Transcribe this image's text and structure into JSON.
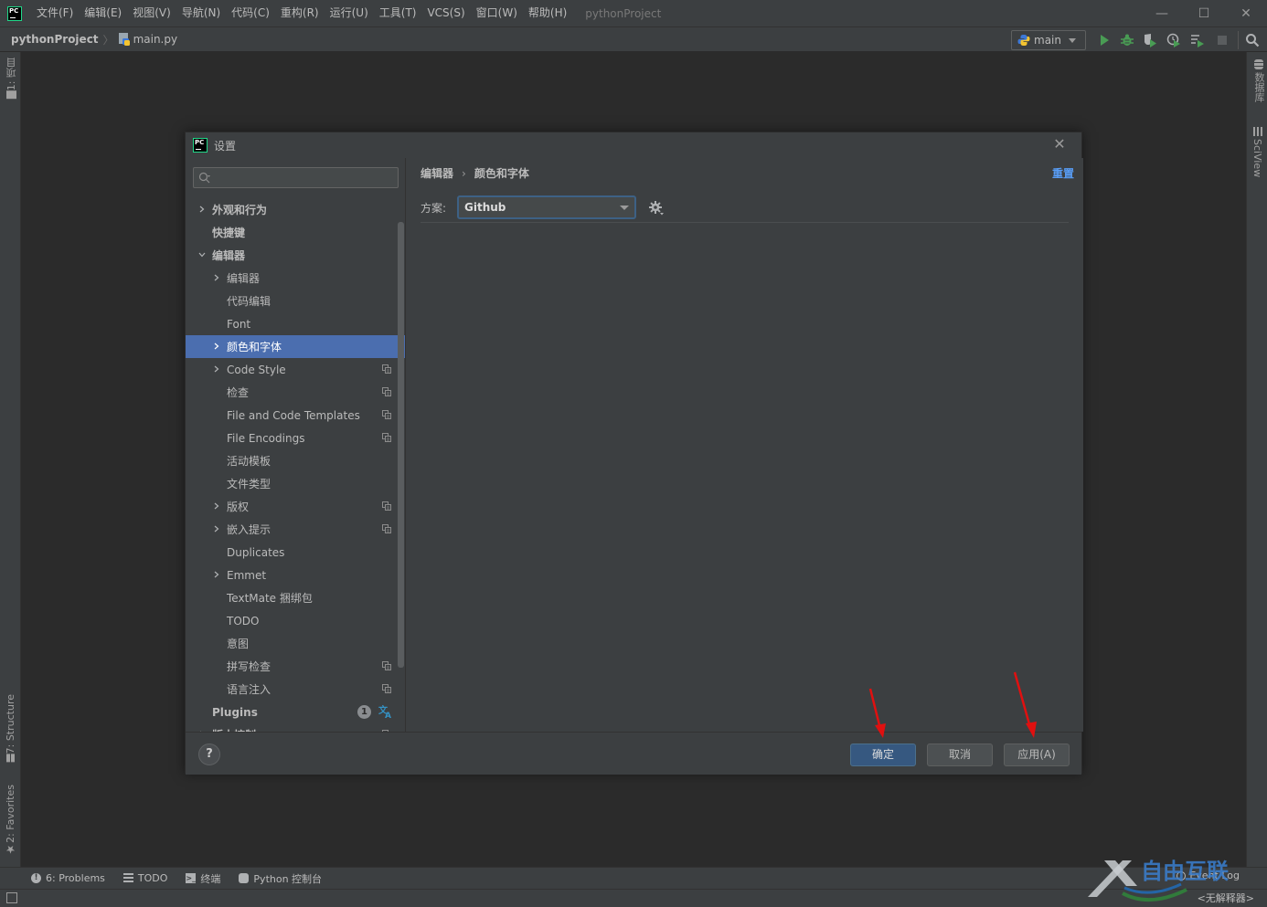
{
  "app": {
    "logo_text": "PC",
    "menu": [
      "文件(F)",
      "编辑(E)",
      "视图(V)",
      "导航(N)",
      "代码(C)",
      "重构(R)",
      "运行(U)",
      "工具(T)",
      "VCS(S)",
      "窗口(W)",
      "帮助(H)"
    ],
    "window_title": "pythonProject",
    "window_controls": {
      "minimize": "—",
      "maximize": "☐",
      "close": "✕"
    }
  },
  "navbar": {
    "project": "pythonProject",
    "file": "main.py",
    "run_config": "main"
  },
  "left_strip": {
    "top_tab": "1: 项目",
    "structure_tab": "7: Structure",
    "favorites_tab": "2: Favorites"
  },
  "right_strip": {
    "database_tab": "数据库",
    "sciview_tab": "SciView"
  },
  "bottom_bar": {
    "tabs": [
      "6: Problems",
      "TODO",
      "终端",
      "Python 控制台"
    ]
  },
  "status": {
    "event_log": "Event Log",
    "interpreter": "<无解释器>"
  },
  "dialog": {
    "logo_text": "PC",
    "title": "设置",
    "close": "✕",
    "search": {
      "value": "",
      "placeholder": ""
    },
    "tree": [
      {
        "label": "外观和行为",
        "level": 0,
        "arrow": "right",
        "bold": true,
        "copy": false
      },
      {
        "label": "快捷键",
        "level": 0,
        "arrow": "none",
        "bold": true,
        "copy": false
      },
      {
        "label": "编辑器",
        "level": 0,
        "arrow": "down",
        "bold": true,
        "copy": false
      },
      {
        "label": "编辑器",
        "level": 1,
        "arrow": "right",
        "bold": false,
        "copy": false
      },
      {
        "label": "代码编辑",
        "level": 1,
        "arrow": "none",
        "bold": false,
        "copy": false
      },
      {
        "label": "Font",
        "level": 1,
        "arrow": "none",
        "bold": false,
        "copy": false
      },
      {
        "label": "颜色和字体",
        "level": 1,
        "arrow": "right",
        "bold": false,
        "copy": false,
        "selected": true
      },
      {
        "label": "Code Style",
        "level": 1,
        "arrow": "right",
        "bold": false,
        "copy": true
      },
      {
        "label": "检查",
        "level": 1,
        "arrow": "none",
        "bold": false,
        "copy": true
      },
      {
        "label": "File and Code Templates",
        "level": 1,
        "arrow": "none",
        "bold": false,
        "copy": true
      },
      {
        "label": "File Encodings",
        "level": 1,
        "arrow": "none",
        "bold": false,
        "copy": true
      },
      {
        "label": "活动模板",
        "level": 1,
        "arrow": "none",
        "bold": false,
        "copy": false
      },
      {
        "label": "文件类型",
        "level": 1,
        "arrow": "none",
        "bold": false,
        "copy": false
      },
      {
        "label": "版权",
        "level": 1,
        "arrow": "right",
        "bold": false,
        "copy": true
      },
      {
        "label": "嵌入提示",
        "level": 1,
        "arrow": "right",
        "bold": false,
        "copy": true
      },
      {
        "label": "Duplicates",
        "level": 1,
        "arrow": "none",
        "bold": false,
        "copy": false
      },
      {
        "label": "Emmet",
        "level": 1,
        "arrow": "right",
        "bold": false,
        "copy": false
      },
      {
        "label": "TextMate 捆绑包",
        "level": 1,
        "arrow": "none",
        "bold": false,
        "copy": false
      },
      {
        "label": "TODO",
        "level": 1,
        "arrow": "none",
        "bold": false,
        "copy": false
      },
      {
        "label": "意图",
        "level": 1,
        "arrow": "none",
        "bold": false,
        "copy": false
      },
      {
        "label": "拼写检查",
        "level": 1,
        "arrow": "none",
        "bold": false,
        "copy": true
      },
      {
        "label": "语言注入",
        "level": 1,
        "arrow": "none",
        "bold": false,
        "copy": true
      },
      {
        "label": "Plugins",
        "level": 0,
        "arrow": "none",
        "bold": true,
        "copy": false,
        "badge": "1",
        "translate": true
      },
      {
        "label": "版本控制",
        "level": 0,
        "arrow": "right",
        "bold": true,
        "copy": true
      }
    ],
    "breadcrumb": [
      "编辑器",
      "颜色和字体"
    ],
    "reset_link": "重置",
    "scheme": {
      "label": "方案:",
      "value": "Github"
    },
    "buttons": {
      "help": "?",
      "ok": "确定",
      "cancel": "取消",
      "apply": "应用(A)"
    },
    "colors": {
      "selection": "#4b6eaf",
      "primary_button": "#365880",
      "link": "#589df6",
      "annotation_arrow": "#e01010"
    }
  }
}
